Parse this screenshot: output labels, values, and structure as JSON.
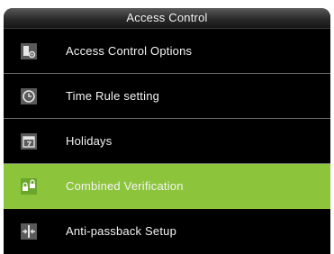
{
  "header": {
    "title": "Access Control"
  },
  "menu": {
    "selected_index": 3,
    "items": [
      {
        "label": "Access Control Options",
        "icon": "access-control-options-icon"
      },
      {
        "label": "Time Rule setting",
        "icon": "clock-icon"
      },
      {
        "label": "Holidays",
        "icon": "calendar-icon"
      },
      {
        "label": "Combined Verification",
        "icon": "padlocks-icon"
      },
      {
        "label": "Anti-passback Setup",
        "icon": "anti-passback-icon"
      }
    ]
  },
  "colors": {
    "selected_background": "#8cc43b",
    "background": "#000000",
    "text": "#f4f4f4"
  }
}
